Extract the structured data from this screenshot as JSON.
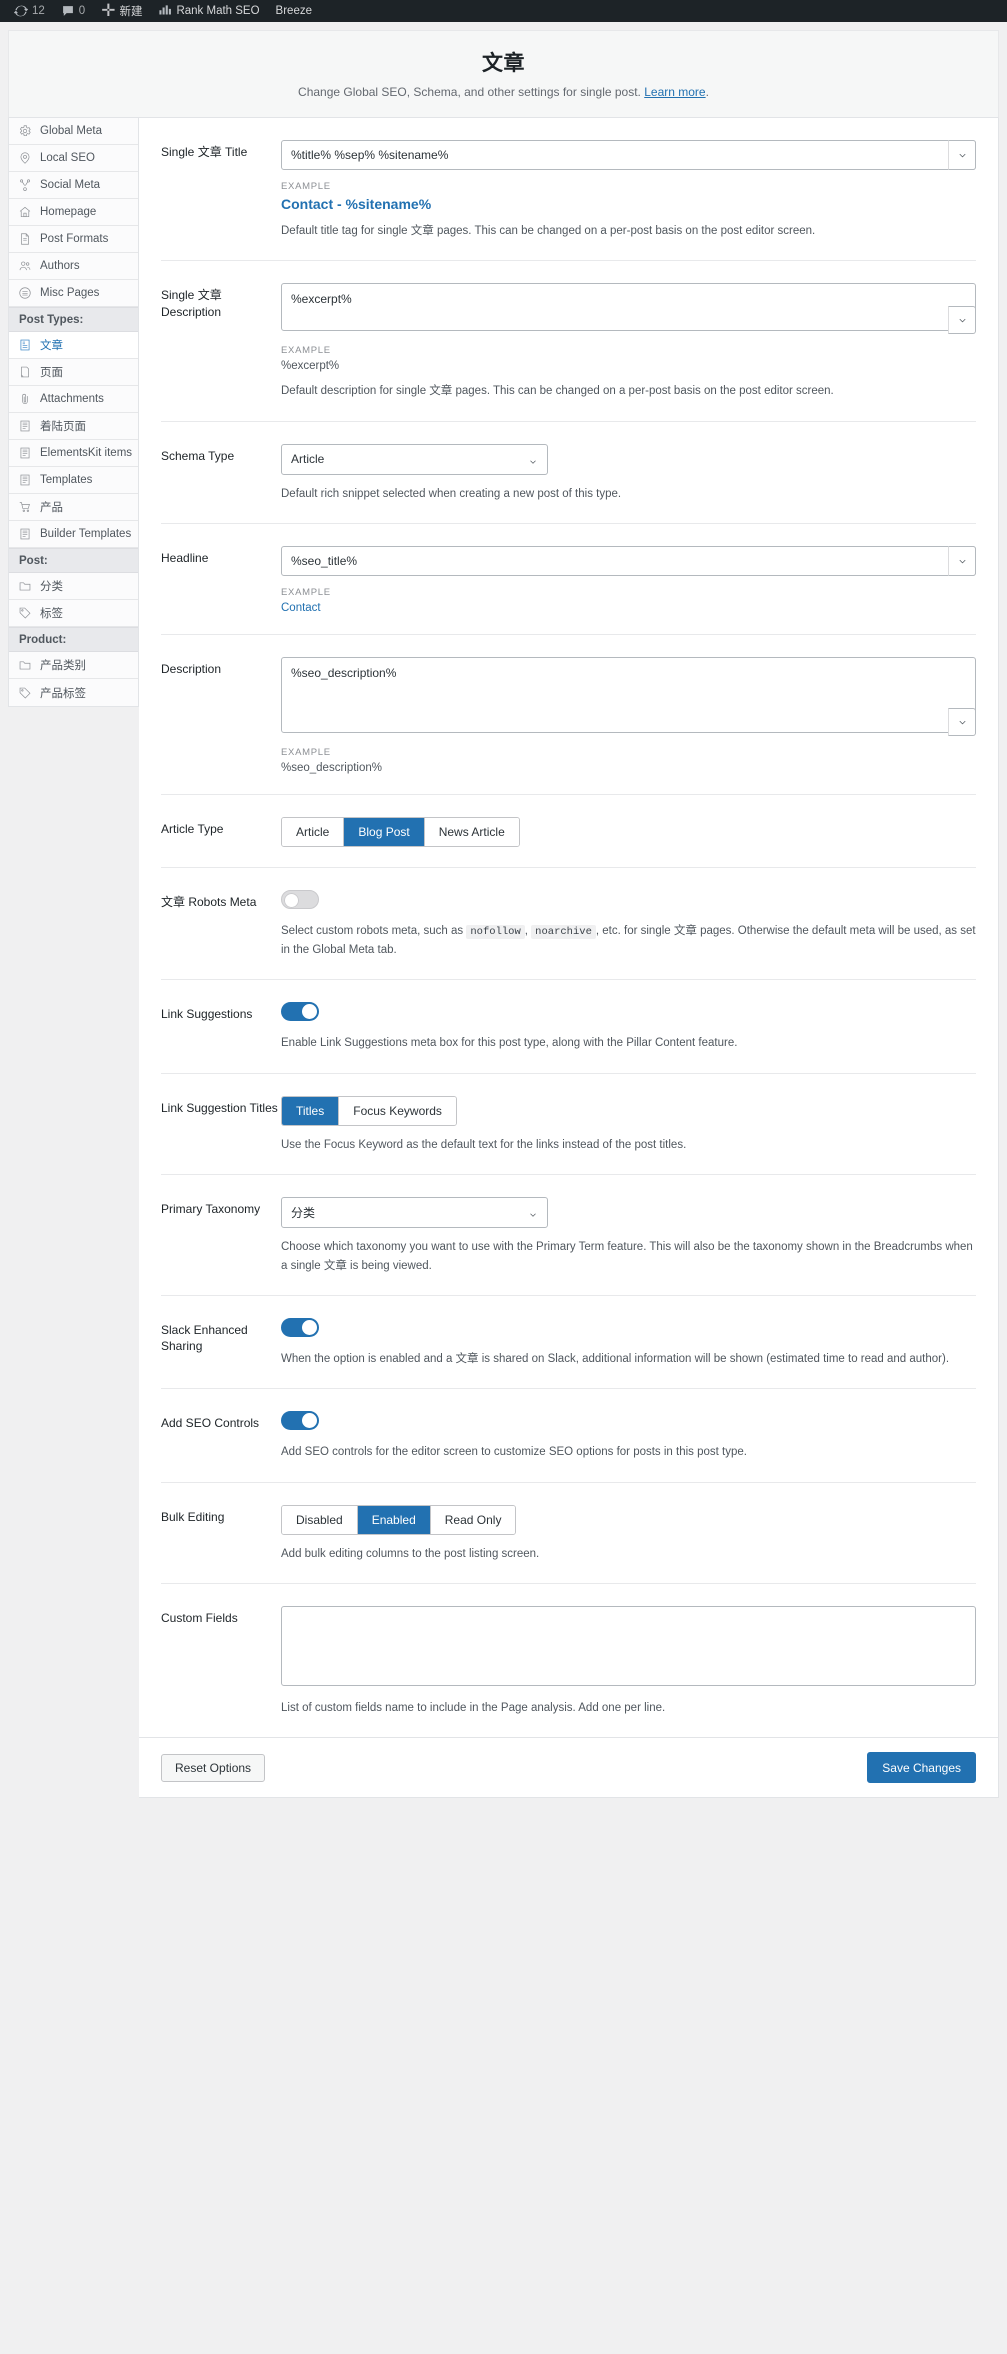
{
  "adminbar": {
    "items": [
      {
        "icon": "wordpress-updates-icon",
        "label": "",
        "count": "12"
      },
      {
        "icon": "comment-bubble-icon",
        "label": "",
        "count": "0"
      },
      {
        "icon": "plus-icon",
        "label": "新建",
        "count": ""
      },
      {
        "icon": "rank-math-logo-icon",
        "label": "Rank Math SEO",
        "count": ""
      },
      {
        "icon": "",
        "label": "Breeze",
        "count": ""
      }
    ]
  },
  "header": {
    "title": "文章",
    "subtitle_before": "Change Global SEO, Schema, and other settings for single post. ",
    "learn_more": "Learn more",
    "subtitle_after": "."
  },
  "sidebar": {
    "items": [
      {
        "label": "Global Meta",
        "icon": "gear-icon",
        "type": "item",
        "active": false
      },
      {
        "label": "Local SEO",
        "icon": "map-pin-icon",
        "type": "item",
        "active": false
      },
      {
        "label": "Social Meta",
        "icon": "share-nodes-icon",
        "type": "item",
        "active": false
      },
      {
        "label": "Homepage",
        "icon": "home-icon",
        "type": "item",
        "active": false
      },
      {
        "label": "Post Formats",
        "icon": "document-icon",
        "type": "item",
        "active": false
      },
      {
        "label": "Authors",
        "icon": "users-icon",
        "type": "item",
        "active": false
      },
      {
        "label": "Misc Pages",
        "icon": "circle-list-icon",
        "type": "item",
        "active": false
      },
      {
        "label": "Post Types:",
        "icon": "",
        "type": "group",
        "active": false
      },
      {
        "label": "文章",
        "icon": "post-icon",
        "type": "item",
        "active": true
      },
      {
        "label": "页面",
        "icon": "page-icon",
        "type": "item",
        "active": false
      },
      {
        "label": "Attachments",
        "icon": "paperclip-icon",
        "type": "item",
        "active": false
      },
      {
        "label": "着陆页面",
        "icon": "post-icon",
        "type": "item",
        "active": false
      },
      {
        "label": "ElementsKit items",
        "icon": "post-icon",
        "type": "item",
        "active": false
      },
      {
        "label": "Templates",
        "icon": "post-icon",
        "type": "item",
        "active": false
      },
      {
        "label": "产品",
        "icon": "cart-icon",
        "type": "item",
        "active": false
      },
      {
        "label": "Builder Templates",
        "icon": "post-icon",
        "type": "item",
        "active": false
      },
      {
        "label": "Post:",
        "icon": "",
        "type": "group",
        "active": false
      },
      {
        "label": "分类",
        "icon": "folder-icon",
        "type": "item",
        "active": false
      },
      {
        "label": "标签",
        "icon": "tag-icon",
        "type": "item",
        "active": false
      },
      {
        "label": "Product:",
        "icon": "",
        "type": "group",
        "active": false
      },
      {
        "label": "产品类别",
        "icon": "folder-icon",
        "type": "item",
        "active": false
      },
      {
        "label": "产品标签",
        "icon": "tag-icon",
        "type": "item",
        "active": false
      }
    ]
  },
  "fields": {
    "single_title": {
      "label": "Single 文章 Title",
      "value": "%title% %sep% %sitename%",
      "example_caption": "Example",
      "example_value": "Contact - %sitename%",
      "help": "Default title tag for single 文章 pages. This can be changed on a per-post basis on the post editor screen."
    },
    "single_description": {
      "label": "Single 文章 Description",
      "value": "%excerpt%",
      "example_caption": "Example",
      "example_value": "%excerpt%",
      "help": "Default description for single 文章 pages. This can be changed on a per-post basis on the post editor screen."
    },
    "schema_type": {
      "label": "Schema Type",
      "value": "Article",
      "options": [
        "Article"
      ],
      "help": "Default rich snippet selected when creating a new post of this type."
    },
    "headline": {
      "label": "Headline",
      "value": "%seo_title%",
      "example_caption": "Example",
      "example_value": "Contact"
    },
    "description": {
      "label": "Description",
      "value": "%seo_description%",
      "example_caption": "Example",
      "example_value": "%seo_description%"
    },
    "article_type": {
      "label": "Article Type",
      "options": [
        "Article",
        "Blog Post",
        "News Article"
      ],
      "selected": "Blog Post"
    },
    "robots_meta": {
      "label": "文章 Robots Meta",
      "enabled": false,
      "help_1": "Select custom robots meta, such as ",
      "code_1": "nofollow",
      "help_2": ", ",
      "code_2": "noarchive",
      "help_3": ", etc. for single 文章 pages. Otherwise the default meta will be used, as set in the Global Meta tab."
    },
    "link_suggestions": {
      "label": "Link Suggestions",
      "enabled": true,
      "help": "Enable Link Suggestions meta box for this post type, along with the Pillar Content feature."
    },
    "link_suggestion_titles": {
      "label": "Link Suggestion Titles",
      "options": [
        "Titles",
        "Focus Keywords"
      ],
      "selected": "Titles",
      "help": "Use the Focus Keyword as the default text for the links instead of the post titles."
    },
    "primary_taxonomy": {
      "label": "Primary Taxonomy",
      "value": "分类",
      "options": [
        "分类"
      ],
      "help": "Choose which taxonomy you want to use with the Primary Term feature. This will also be the taxonomy shown in the Breadcrumbs when a single 文章 is being viewed."
    },
    "slack_sharing": {
      "label": "Slack Enhanced Sharing",
      "enabled": true,
      "help": "When the option is enabled and a 文章 is shared on Slack, additional information will be shown (estimated time to read and author)."
    },
    "seo_controls": {
      "label": "Add SEO Controls",
      "enabled": true,
      "help": "Add SEO controls for the editor screen to customize SEO options for posts in this post type."
    },
    "bulk_editing": {
      "label": "Bulk Editing",
      "options": [
        "Disabled",
        "Enabled",
        "Read Only"
      ],
      "selected": "Enabled",
      "help": "Add bulk editing columns to the post listing screen."
    },
    "custom_fields": {
      "label": "Custom Fields",
      "value": "",
      "help": "List of custom fields name to include in the Page analysis. Add one per line."
    }
  },
  "footer": {
    "reset_label": "Reset Options",
    "save_label": "Save Changes"
  },
  "colors": {
    "accent": "#2271b1",
    "adminbar_bg": "#1d2327",
    "panel_bg": "#ffffff"
  }
}
